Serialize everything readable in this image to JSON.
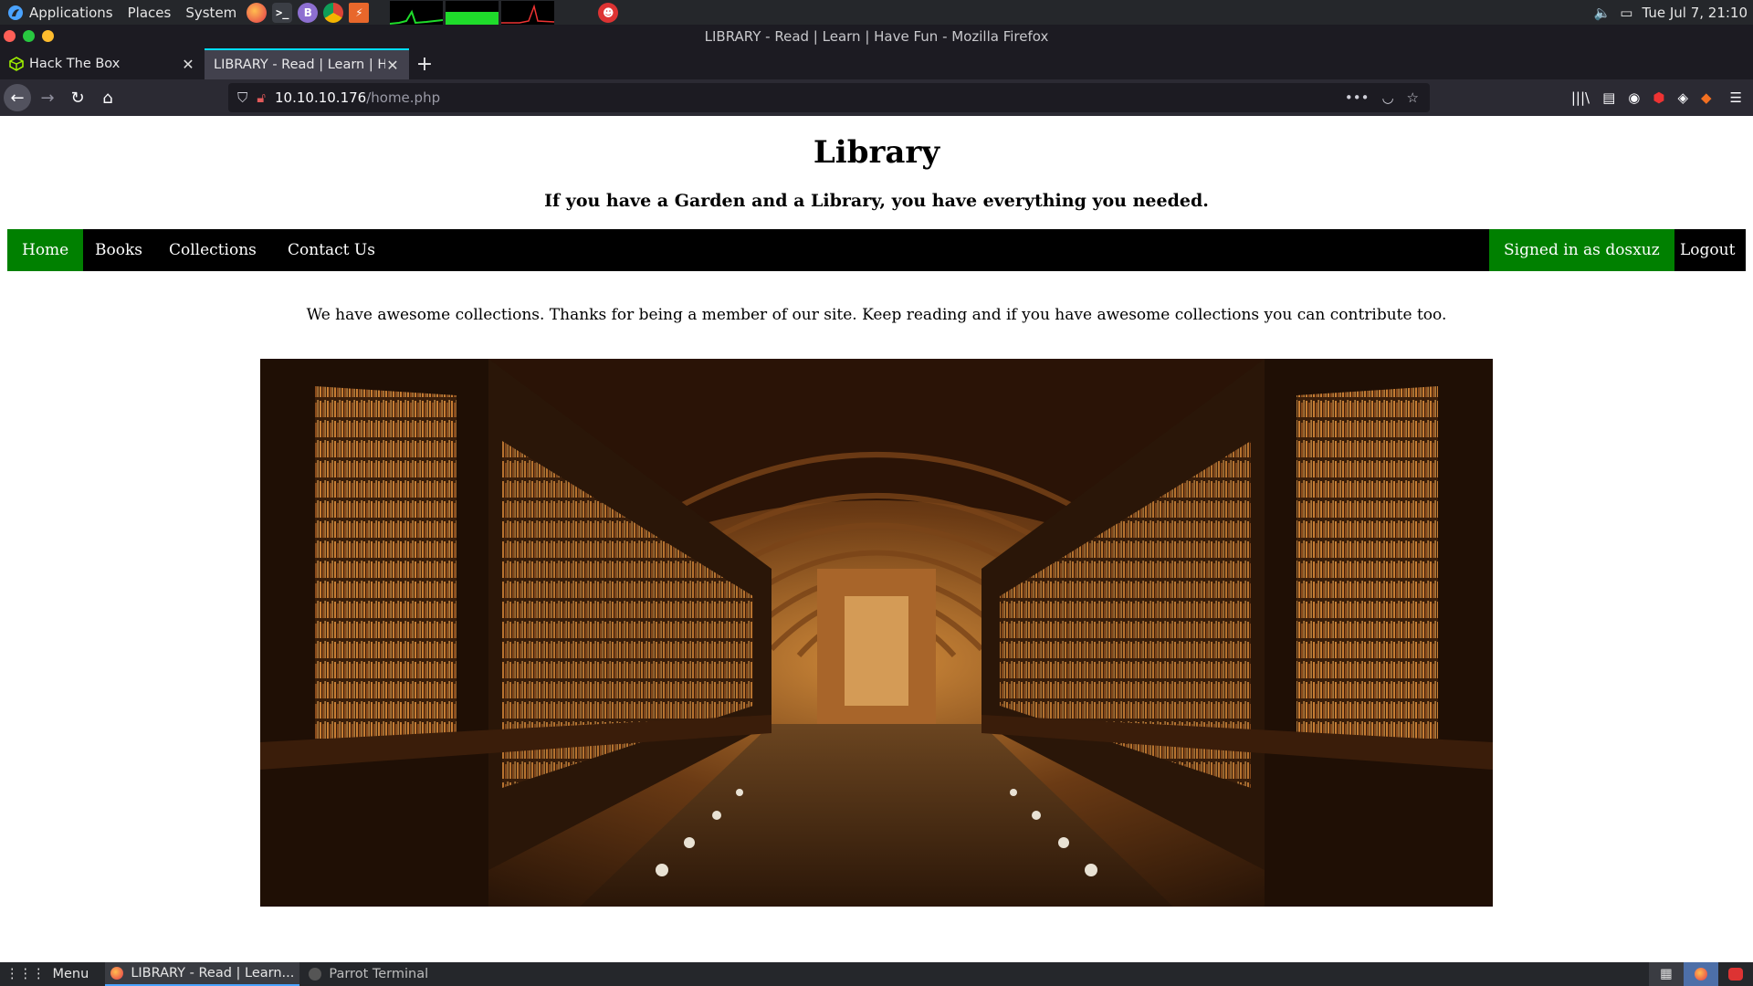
{
  "system_panel": {
    "menus": [
      "Applications",
      "Places",
      "System"
    ],
    "clock": "Tue Jul 7, 21:10"
  },
  "window": {
    "title": "LIBRARY - Read | Learn | Have Fun - Mozilla Firefox"
  },
  "tabs": [
    {
      "label": "Hack The Box",
      "icon": "hackthebox-cube-icon"
    },
    {
      "label": "LIBRARY - Read | Learn | Ha",
      "icon": "none"
    }
  ],
  "url": {
    "host": "10.10.10.176",
    "path": "/home.php"
  },
  "site": {
    "title": "Library",
    "tagline": "If you have a Garden and a Library, you have everything you needed.",
    "nav_left": [
      "Home",
      "Books",
      "Collections",
      "Contact Us"
    ],
    "active_item": "Home",
    "signed_in": "Signed in as dosxuz",
    "logout": "Logout",
    "intro": "We have awesome collections. Thanks for being a member of our site. Keep reading and if you have awesome collections you can contribute too.",
    "hero_image": "library-hall-photo"
  },
  "taskbar": {
    "menu_label": "Menu",
    "items": [
      "LIBRARY - Read | Learn...",
      "Parrot Terminal"
    ]
  },
  "colors": {
    "nav_bg": "#000000",
    "nav_active": "#008000",
    "panel_bg": "#25272b",
    "browser_bg": "#1c1b22",
    "tab_active": "#42414d"
  }
}
